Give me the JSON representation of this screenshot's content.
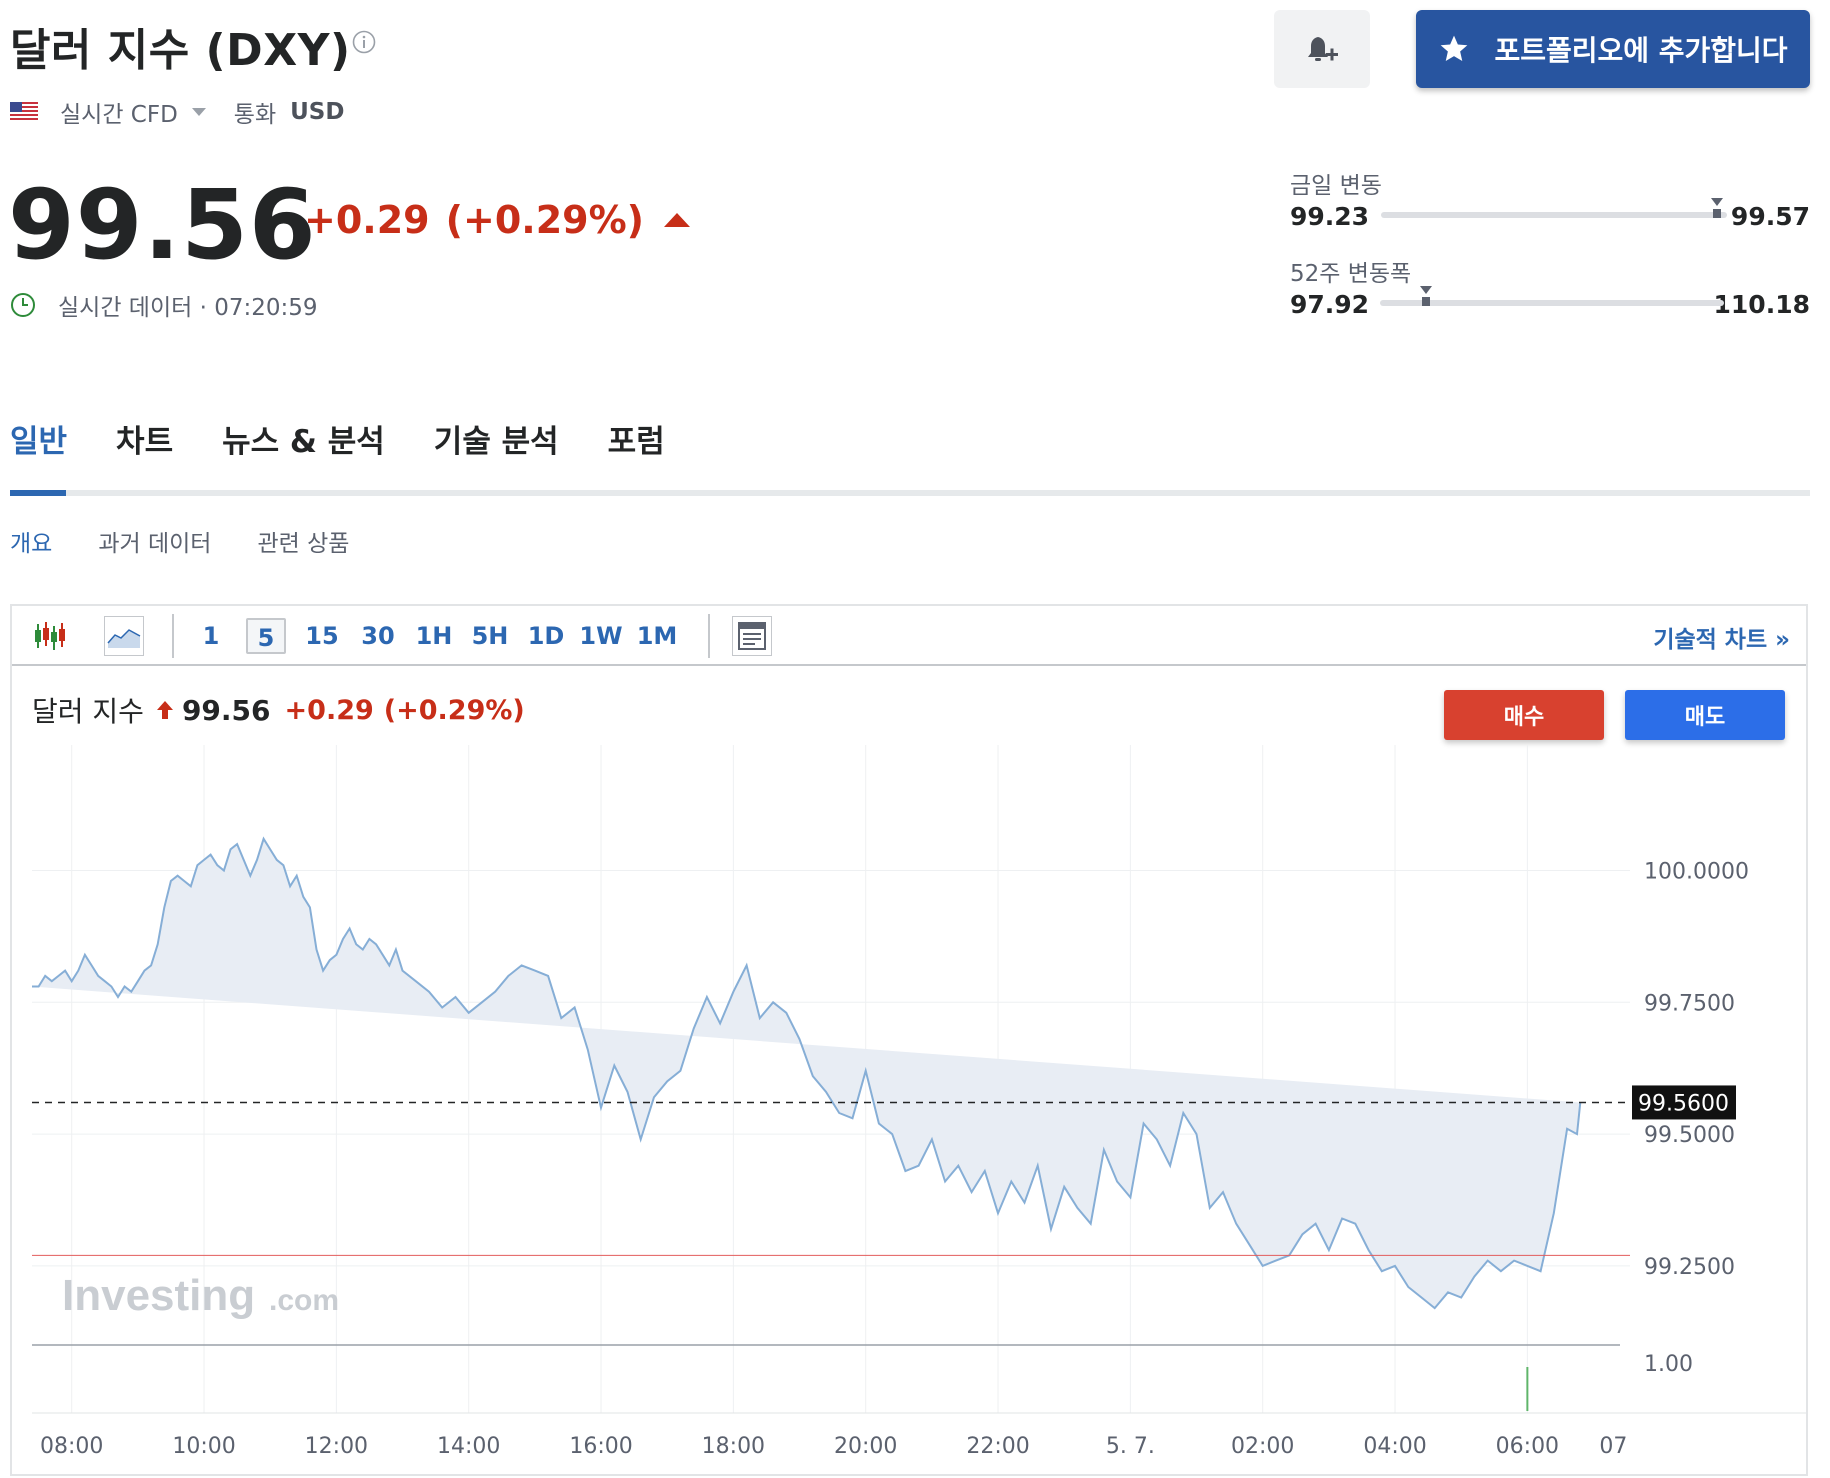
{
  "header": {
    "title": "달러 지수 (DXY)",
    "market_type": "실시간 CFD",
    "currency_label": "통화",
    "currency": "USD",
    "portfolio_button": "포트폴리오에 추가합니다"
  },
  "quote": {
    "price": "99.56",
    "change": "+0.29",
    "change_pct": "(+0.29%)",
    "realtime_text": "실시간 데이터 · 07:20:59"
  },
  "ranges": {
    "day": {
      "label": "금일 변동",
      "low": "99.23",
      "high": "99.57",
      "current_fraction": 0.97
    },
    "week52": {
      "label": "52주 변동폭",
      "low": "97.92",
      "high": "110.18",
      "current_fraction": 0.134
    }
  },
  "tabs": [
    "일반",
    "차트",
    "뉴스 & 분석",
    "기술 분석",
    "포럼"
  ],
  "active_tab": 0,
  "subtabs": [
    "개요",
    "과거 데이터",
    "관련 상품"
  ],
  "active_subtab": 0,
  "chart_toolbar": {
    "timeframes": [
      "1",
      "5",
      "15",
      "30",
      "1H",
      "5H",
      "1D",
      "1W",
      "1M"
    ],
    "selected_timeframe": "5",
    "technical_link": "기술적 차트 »"
  },
  "chart_header": {
    "name": "달러 지수",
    "price": "99.56",
    "change": "+0.29",
    "change_pct": "(+0.29%)",
    "buy_label": "매수",
    "sell_label": "매도"
  },
  "colors": {
    "accent": "#2c67b1",
    "brand_button": "#2855a0",
    "positive_change": "#c72e18",
    "buy": "#d8412f",
    "sell": "#2c6ee8",
    "line": "#86aed6",
    "area_fill": "#e8edf4",
    "prev_close_line": "#e25c5c"
  },
  "icons": {
    "info": "info-circle-icon",
    "flag": "us-flag-icon",
    "bell": "bell-plus-icon",
    "star": "star-icon",
    "clock": "clock-icon",
    "candles": "candlestick-chart-icon",
    "area": "area-chart-icon",
    "layout": "chart-layout-icon"
  },
  "chart_data": {
    "type": "area",
    "interval_minutes": 5,
    "watermark": "Investing.com",
    "y_ticks": [
      "100.0000",
      "99.7500",
      "99.5000",
      "99.2500"
    ],
    "ylim": [
      99.1,
      100.2
    ],
    "current_price_label": "99.5600",
    "current_price": 99.56,
    "prev_close": 99.27,
    "volume_tick": "1.00",
    "x_ticks": [
      {
        "label": "08:00",
        "h": 8.0
      },
      {
        "label": "10:00",
        "h": 10.0
      },
      {
        "label": "12:00",
        "h": 12.0
      },
      {
        "label": "14:00",
        "h": 14.0
      },
      {
        "label": "16:00",
        "h": 16.0
      },
      {
        "label": "18:00",
        "h": 18.0
      },
      {
        "label": "20:00",
        "h": 20.0
      },
      {
        "label": "22:00",
        "h": 22.0
      },
      {
        "label": "5. 7.",
        "h": 24.0
      },
      {
        "label": "02:00",
        "h": 26.0
      },
      {
        "label": "04:00",
        "h": 28.0
      },
      {
        "label": "06:00",
        "h": 30.0
      },
      {
        "label": "07",
        "h": 31.3
      }
    ],
    "x_range_hours": [
      7.4,
      31.4
    ],
    "series": [
      {
        "x_hours": [
          7.4,
          7.5,
          7.6,
          7.7,
          7.8,
          7.9,
          8.0,
          8.1,
          8.2,
          8.3,
          8.4,
          8.5,
          8.6,
          8.7,
          8.8,
          8.9,
          9.0,
          9.1,
          9.2,
          9.3,
          9.4,
          9.5,
          9.6,
          9.7,
          9.8,
          9.9,
          10.0,
          10.1,
          10.2,
          10.3,
          10.4,
          10.5,
          10.6,
          10.7,
          10.8,
          10.9,
          11.0,
          11.1,
          11.2,
          11.3,
          11.4,
          11.5,
          11.6,
          11.7,
          11.8,
          11.9,
          12.0,
          12.1,
          12.2,
          12.3,
          12.4,
          12.5,
          12.6,
          12.7,
          12.8,
          12.9,
          13.0,
          13.2,
          13.4,
          13.6,
          13.8,
          14.0,
          14.2,
          14.4,
          14.6,
          14.8,
          15.0,
          15.2,
          15.4,
          15.6,
          15.8,
          16.0,
          16.2,
          16.4,
          16.6,
          16.8,
          17.0,
          17.2,
          17.4,
          17.6,
          17.8,
          18.0,
          18.2,
          18.4,
          18.6,
          18.8,
          19.0,
          19.2,
          19.4,
          19.6,
          19.8,
          20.0,
          20.2,
          20.4,
          20.6,
          20.8,
          21.0,
          21.2,
          21.4,
          21.6,
          21.8,
          22.0,
          22.2,
          22.4,
          22.6,
          22.8,
          23.0,
          23.2,
          23.4,
          23.6,
          23.8,
          24.0,
          24.2,
          24.4,
          24.6,
          24.8,
          25.0,
          25.2,
          25.4,
          25.6,
          25.8,
          26.0,
          26.2,
          26.4,
          26.6,
          26.8,
          27.0,
          27.2,
          27.4,
          27.6,
          27.8,
          28.0,
          28.2,
          28.4,
          28.6,
          28.8,
          29.0,
          29.2,
          29.4,
          29.6,
          29.8,
          30.0,
          30.2,
          30.4,
          30.6,
          30.75,
          30.8,
          30.9,
          31.0,
          31.1
        ],
        "values": [
          99.78,
          99.78,
          99.8,
          99.79,
          99.8,
          99.81,
          99.79,
          99.81,
          99.84,
          99.82,
          99.8,
          99.79,
          99.78,
          99.76,
          99.78,
          99.77,
          99.79,
          99.81,
          99.82,
          99.86,
          99.93,
          99.98,
          99.99,
          99.98,
          99.97,
          100.01,
          100.02,
          100.03,
          100.01,
          100.0,
          100.04,
          100.05,
          100.02,
          99.99,
          100.02,
          100.06,
          100.04,
          100.02,
          100.01,
          99.97,
          99.99,
          99.95,
          99.93,
          99.85,
          99.81,
          99.83,
          99.84,
          99.87,
          99.89,
          99.86,
          99.85,
          99.87,
          99.86,
          99.84,
          99.82,
          99.85,
          99.81,
          99.79,
          99.77,
          99.74,
          99.76,
          99.73,
          99.75,
          99.77,
          99.8,
          99.82,
          99.81,
          99.8,
          99.72,
          99.74,
          99.66,
          99.55,
          99.63,
          99.58,
          99.49,
          99.57,
          99.6,
          99.62,
          99.7,
          99.76,
          99.71,
          99.77,
          99.82,
          99.72,
          99.75,
          99.73,
          99.68,
          99.61,
          99.58,
          99.54,
          99.53,
          99.62,
          99.52,
          99.5,
          99.43,
          99.44,
          99.49,
          99.41,
          99.44,
          99.39,
          99.43,
          99.35,
          99.41,
          99.37,
          99.44,
          99.32,
          99.4,
          99.36,
          99.33,
          99.47,
          99.41,
          99.38,
          99.52,
          99.49,
          99.44,
          99.54,
          99.5,
          99.36,
          99.39,
          99.33,
          99.29,
          99.25,
          99.26,
          99.27,
          99.31,
          99.33,
          99.28,
          99.34,
          99.33,
          99.28,
          99.24,
          99.25,
          99.21,
          99.19,
          99.17,
          99.2,
          99.19,
          99.23,
          99.26,
          99.24,
          99.26,
          99.25,
          99.24,
          99.35,
          99.51,
          99.5,
          99.56
        ]
      }
    ]
  }
}
